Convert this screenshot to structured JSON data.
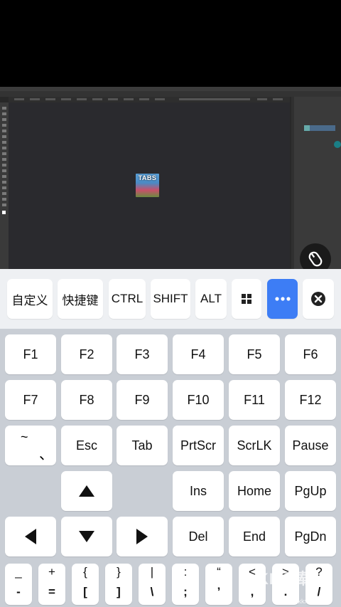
{
  "photoshop": {
    "thumbnail_text": "TABS"
  },
  "toolbar_keys": [
    {
      "label": "自定义"
    },
    {
      "label": "快捷键"
    },
    {
      "label": "CTRL"
    },
    {
      "label": "SHIFT"
    },
    {
      "label": "ALT"
    },
    {
      "icon": "windows-icon"
    },
    {
      "icon": "more-dots-icon",
      "active": true
    },
    {
      "icon": "close-circle-icon"
    }
  ],
  "function_keys": [
    "F1",
    "F2",
    "F3",
    "F4",
    "F5",
    "F6",
    "F7",
    "F8",
    "F9",
    "F10",
    "F11",
    "F12"
  ],
  "special_keys": {
    "tilde_top": "~",
    "tilde_bottom": "、",
    "esc": "Esc",
    "tab": "Tab",
    "prtscr": "PrtScr",
    "scrlk": "ScrLK",
    "pause": "Pause",
    "ins": "Ins",
    "home": "Home",
    "pgup": "PgUp",
    "del": "Del",
    "end": "End",
    "pgdn": "PgDn"
  },
  "arrow_keys": [
    "arrow-up-icon",
    "arrow-left-icon",
    "arrow-down-icon",
    "arrow-right-icon"
  ],
  "symbol_keys": [
    {
      "top": "_",
      "bottom": "-"
    },
    {
      "top": "+",
      "bottom": "="
    },
    {
      "top": "{",
      "bottom": "["
    },
    {
      "top": "}",
      "bottom": "]"
    },
    {
      "top": "|",
      "bottom": "\\"
    },
    {
      "top": ":",
      "bottom": ";"
    },
    {
      "top": "“",
      "bottom": "’"
    },
    {
      "top": "<",
      "bottom": ","
    },
    {
      "top": ">",
      "bottom": "."
    },
    {
      "top": "?",
      "bottom": "/"
    }
  ],
  "watermark": {
    "text": "KK下载",
    "url": "www.kkx.net"
  },
  "colors": {
    "accent": "#3d7df5",
    "keyboard_bg": "#c9ced5",
    "key": "#ffffff"
  }
}
